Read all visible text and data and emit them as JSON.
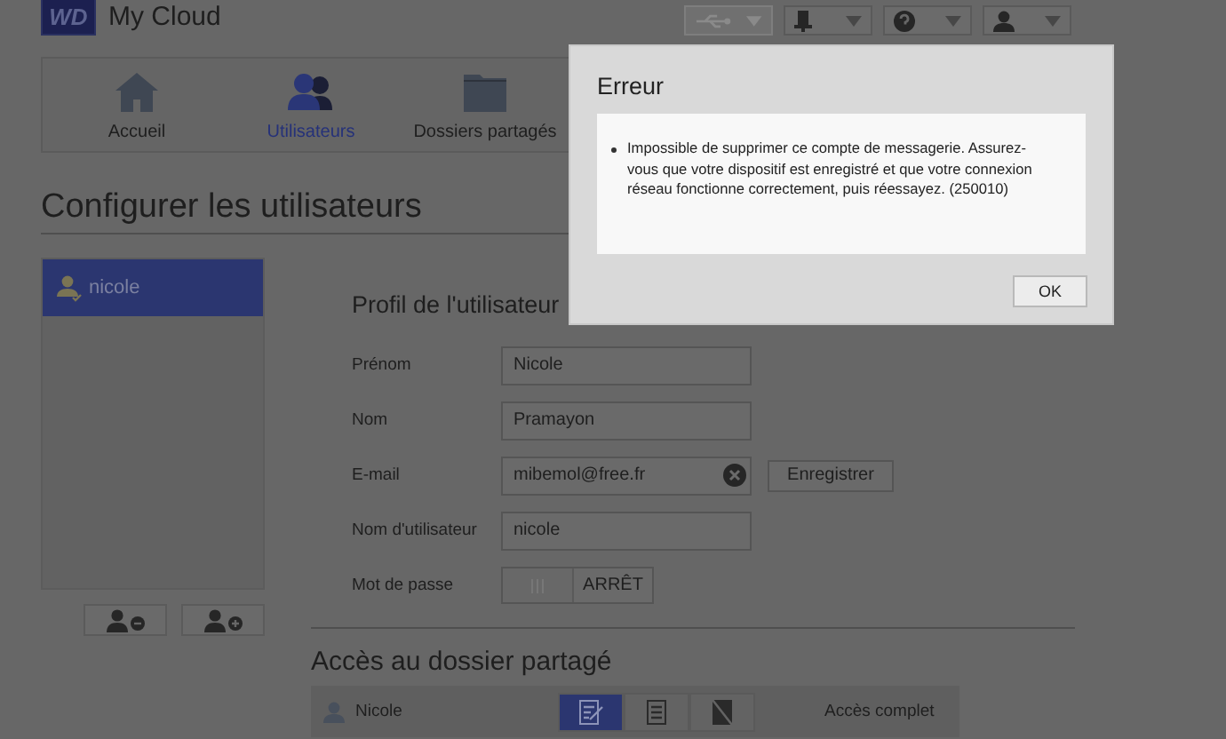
{
  "header": {
    "logo": "WD",
    "title": "My Cloud"
  },
  "toolbar": [
    {
      "kind": "usb",
      "disabled": true
    },
    {
      "kind": "alert",
      "disabled": false
    },
    {
      "kind": "help",
      "disabled": false
    },
    {
      "kind": "user",
      "disabled": false
    }
  ],
  "nav_tabs": [
    {
      "label": "Accueil",
      "kind": "home",
      "selected": false
    },
    {
      "label": "Utilisateurs",
      "kind": "users",
      "selected": true
    },
    {
      "label": "Dossiers partagés",
      "kind": "folder",
      "selected": false
    }
  ],
  "page_title": "Configurer les utilisateurs",
  "users": [
    {
      "name": "nicole",
      "selected": true
    }
  ],
  "user_buttons": [
    {
      "kind": "remove"
    },
    {
      "kind": "add"
    }
  ],
  "profile": {
    "title": "Profil de l'utilisateur",
    "fields": [
      {
        "label": "Prénom",
        "kind": "text",
        "value": "Nicole"
      },
      {
        "label": "Nom",
        "kind": "text",
        "value": "Pramayon"
      },
      {
        "label": "E-mail",
        "kind": "email",
        "value": "mibemol@free.fr",
        "button": "Enregistrer"
      },
      {
        "label": "Nom d'utilisateur",
        "kind": "text",
        "value": "nicole"
      },
      {
        "label": "Mot de passe",
        "kind": "toggle",
        "on": false,
        "value": "ARRÊT"
      }
    ]
  },
  "shared_access": {
    "title": "Accès au dossier partagé",
    "rows": [
      {
        "name": "Nicole",
        "access": "Accès complet",
        "options": [
          {
            "kind": "write",
            "selected": true
          },
          {
            "kind": "read",
            "selected": false
          },
          {
            "kind": "deny",
            "selected": false
          }
        ]
      }
    ]
  },
  "dialog": {
    "title": "Erreur",
    "messages": [
      "Impossible de supprimer ce compte de messagerie. Assurez-vous que votre dispositif est enregistré et que votre connexion réseau fonctionne correctement, puis réessayez. (250010)"
    ],
    "button": "OK"
  }
}
